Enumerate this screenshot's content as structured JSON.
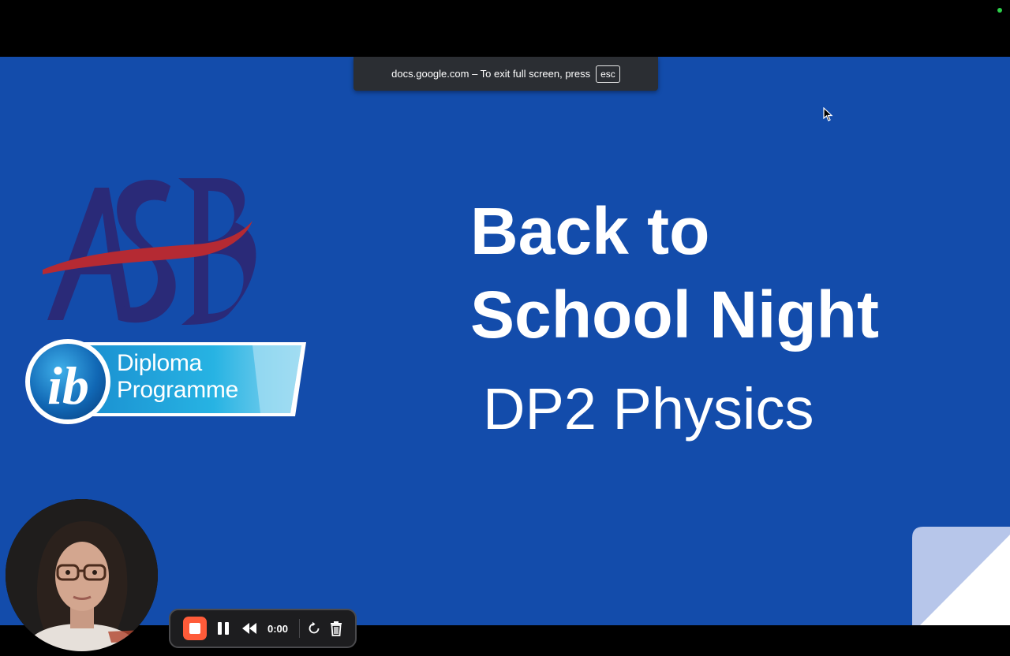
{
  "fullscreen_toast": {
    "message": "docs.google.com – To exit full screen, press",
    "key": "esc"
  },
  "slide": {
    "title_line1": "Back to",
    "title_line2": "School Night",
    "subtitle": "DP2 Physics",
    "ib_logo": {
      "line1": "Diploma",
      "line2": "Programme",
      "mark": "ib"
    },
    "asb_logo": {
      "text": "ASB"
    },
    "colors": {
      "background": "#134cab",
      "asb_navy": "#2a2a78",
      "asb_red": "#b52a33",
      "ib_ribbon": "#1ea9e0"
    }
  },
  "recorder": {
    "timer": "0:00",
    "stop_color": "#ff5b39",
    "icons": [
      "stop-icon",
      "pause-icon",
      "rewind-icon",
      "restart-icon",
      "trash-icon"
    ]
  }
}
